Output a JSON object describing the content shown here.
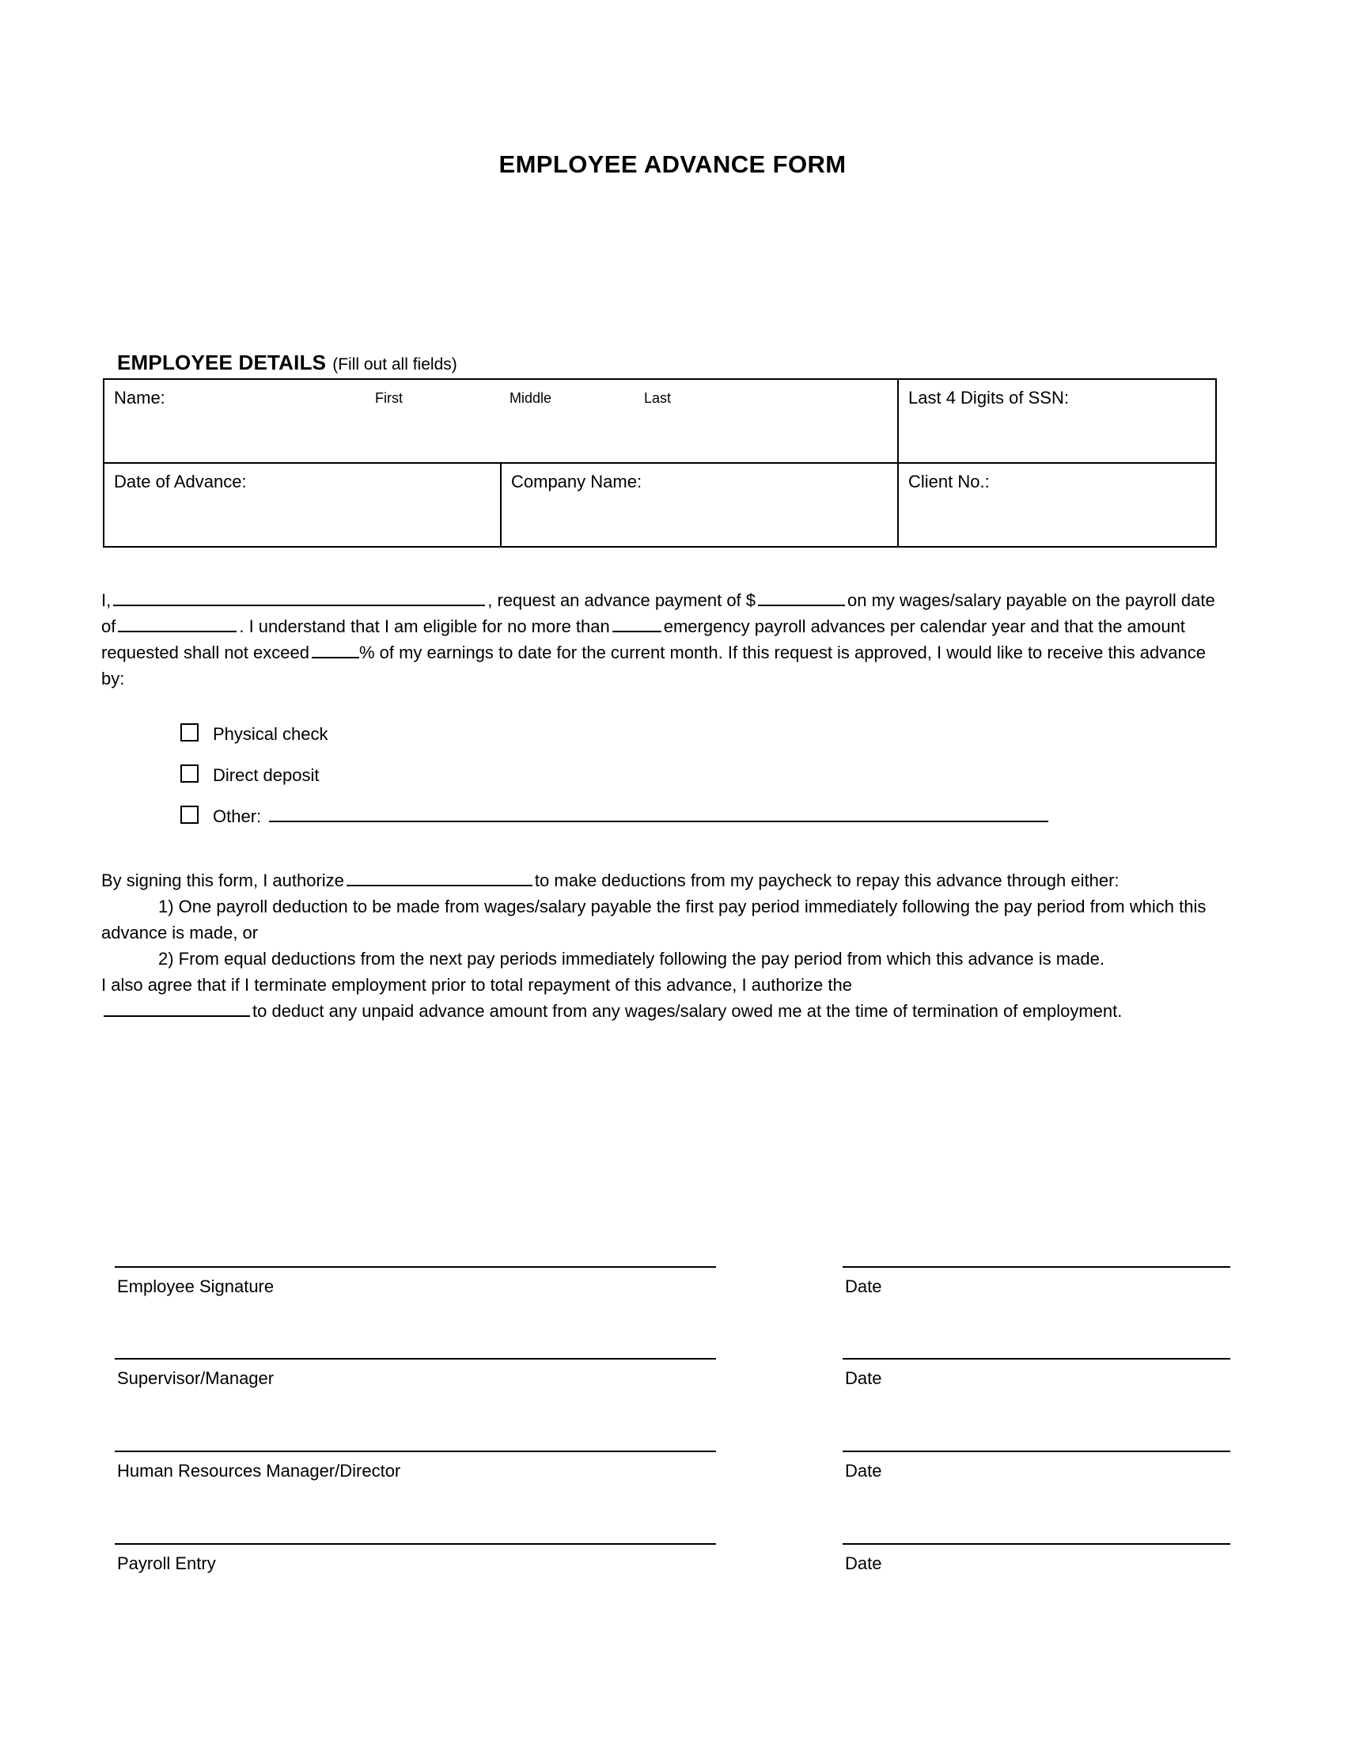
{
  "document": {
    "title": "EMPLOYEE ADVANCE FORM"
  },
  "details_section": {
    "heading_strong": "EMPLOYEE DETAILS",
    "heading_note": "(Fill out all fields)",
    "rows": [
      {
        "name_label": "Name:",
        "sub_first": "First",
        "sub_middle": "Middle",
        "sub_last": "Last",
        "ssn_label": "Last 4 Digits of SSN:"
      },
      {
        "date_label": "Date of Advance:",
        "company_label": "Company Name:",
        "client_label": "Client No.:"
      }
    ]
  },
  "request_paragraph": {
    "t1": "I,",
    "t2": ", request an advance payment of $",
    "t3": "on my wages/salary payable on the payroll date of",
    "t4": ". I understand that I am eligible for no more than",
    "t5": "emergency payroll advances per calendar year and that the amount requested shall not exceed",
    "t6": "% of my earnings to date for the current month. If this request is approved, I would like to receive this advance by:"
  },
  "payment_options": [
    {
      "label": "Physical check",
      "icon": "empty-checkbox-icon",
      "has_rule": false
    },
    {
      "label": "Direct deposit",
      "icon": "empty-checkbox-icon",
      "has_rule": false
    },
    {
      "label": "Other:",
      "icon": "empty-checkbox-icon",
      "has_rule": true
    }
  ],
  "authorization_paragraph": {
    "a1": "By signing this form, I authorize",
    "a2": "to make deductions from my paycheck to repay this advance through either:",
    "a3": "1) One payroll deduction to be made from wages/salary payable the first pay period immediately following the pay period from which this advance is made, or",
    "a4": "2) From equal deductions from the next pay periods immediately following the pay period from which this advance is made.",
    "a5": "I also agree that if I terminate employment prior to total repayment of this advance, I authorize the",
    "a6": "to deduct any unpaid advance amount from any wages/salary owed me at the time of termination of employment."
  },
  "signature_blocks": [
    {
      "label": "Employee Signature",
      "date_label": "Date"
    },
    {
      "label": "Supervisor/Manager",
      "date_label": "Date"
    },
    {
      "label": "Human Resources Manager/Director",
      "date_label": "Date"
    },
    {
      "label": "Payroll Entry",
      "date_label": "Date"
    }
  ],
  "colors": {
    "page_background": "#ffffff",
    "text": "#000000",
    "rule": "#000000"
  }
}
